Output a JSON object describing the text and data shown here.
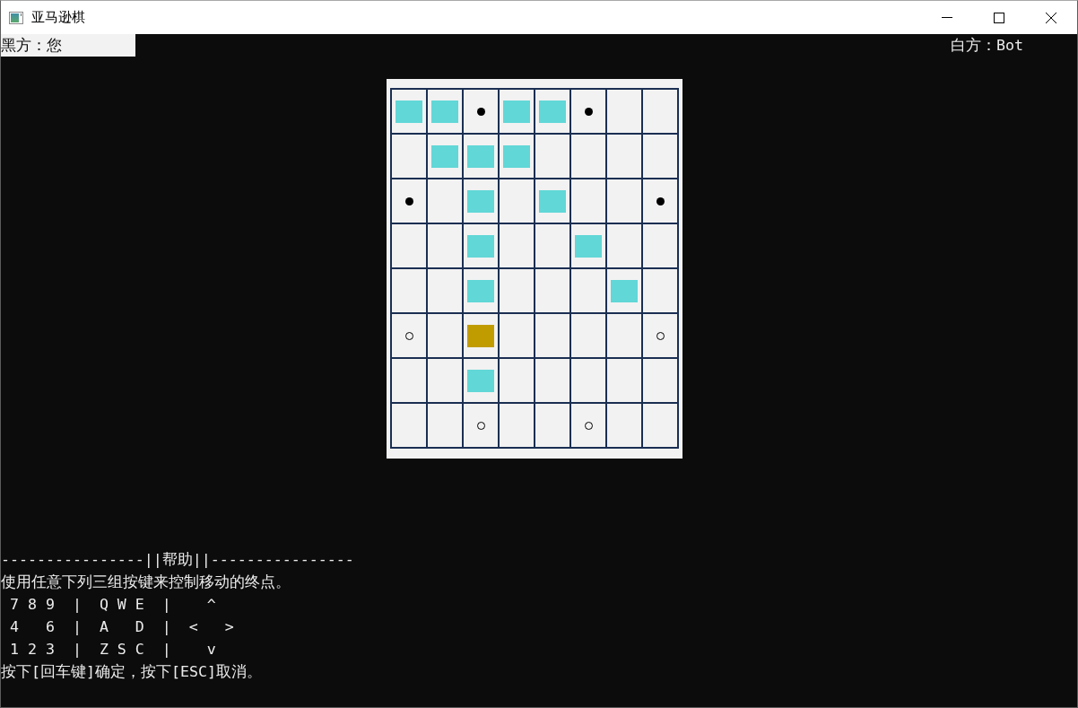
{
  "window": {
    "title": "亚马逊棋"
  },
  "players": [
    {
      "label": "黑方：您",
      "active": true
    },
    {
      "label": "白方：Bot",
      "active": false
    }
  ],
  "board": {
    "rows": [
      {
        "cells": [
          {
            "kind": "block",
            "selected": false
          },
          {
            "kind": "block",
            "selected": false
          },
          {
            "kind": "black",
            "selected": false
          },
          {
            "kind": "block",
            "selected": false
          },
          {
            "kind": "block",
            "selected": false
          },
          {
            "kind": "black",
            "selected": false
          },
          {
            "kind": "empty",
            "selected": false
          },
          {
            "kind": "empty",
            "selected": false
          }
        ]
      },
      {
        "cells": [
          {
            "kind": "empty",
            "selected": false
          },
          {
            "kind": "block",
            "selected": false
          },
          {
            "kind": "block",
            "selected": false
          },
          {
            "kind": "block",
            "selected": false
          },
          {
            "kind": "empty",
            "selected": false
          },
          {
            "kind": "empty",
            "selected": false
          },
          {
            "kind": "empty",
            "selected": false
          },
          {
            "kind": "empty",
            "selected": false
          }
        ]
      },
      {
        "cells": [
          {
            "kind": "black",
            "selected": false
          },
          {
            "kind": "empty",
            "selected": false
          },
          {
            "kind": "block",
            "selected": false
          },
          {
            "kind": "empty",
            "selected": false
          },
          {
            "kind": "block",
            "selected": false
          },
          {
            "kind": "empty",
            "selected": false
          },
          {
            "kind": "empty",
            "selected": false
          },
          {
            "kind": "black",
            "selected": false
          }
        ]
      },
      {
        "cells": [
          {
            "kind": "empty",
            "selected": false
          },
          {
            "kind": "empty",
            "selected": false
          },
          {
            "kind": "block",
            "selected": false
          },
          {
            "kind": "empty",
            "selected": false
          },
          {
            "kind": "empty",
            "selected": false
          },
          {
            "kind": "block",
            "selected": false
          },
          {
            "kind": "empty",
            "selected": false
          },
          {
            "kind": "empty",
            "selected": false
          }
        ]
      },
      {
        "cells": [
          {
            "kind": "empty",
            "selected": false
          },
          {
            "kind": "empty",
            "selected": false
          },
          {
            "kind": "block",
            "selected": false
          },
          {
            "kind": "empty",
            "selected": false
          },
          {
            "kind": "empty",
            "selected": false
          },
          {
            "kind": "empty",
            "selected": false
          },
          {
            "kind": "block",
            "selected": false
          },
          {
            "kind": "empty",
            "selected": false
          }
        ]
      },
      {
        "cells": [
          {
            "kind": "white",
            "selected": false
          },
          {
            "kind": "empty",
            "selected": false
          },
          {
            "kind": "empty",
            "selected": true
          },
          {
            "kind": "empty",
            "selected": false
          },
          {
            "kind": "empty",
            "selected": false
          },
          {
            "kind": "empty",
            "selected": false
          },
          {
            "kind": "empty",
            "selected": false
          },
          {
            "kind": "white",
            "selected": false
          }
        ]
      },
      {
        "cells": [
          {
            "kind": "empty",
            "selected": false
          },
          {
            "kind": "empty",
            "selected": false
          },
          {
            "kind": "block",
            "selected": false
          },
          {
            "kind": "empty",
            "selected": false
          },
          {
            "kind": "empty",
            "selected": false
          },
          {
            "kind": "empty",
            "selected": false
          },
          {
            "kind": "empty",
            "selected": false
          },
          {
            "kind": "empty",
            "selected": false
          }
        ]
      },
      {
        "cells": [
          {
            "kind": "empty",
            "selected": false
          },
          {
            "kind": "empty",
            "selected": false
          },
          {
            "kind": "white",
            "selected": false
          },
          {
            "kind": "empty",
            "selected": false
          },
          {
            "kind": "empty",
            "selected": false
          },
          {
            "kind": "white",
            "selected": false
          },
          {
            "kind": "empty",
            "selected": false
          },
          {
            "kind": "empty",
            "selected": false
          }
        ]
      }
    ]
  },
  "help": {
    "heading": "----------------||帮助||----------------",
    "lines": [
      "使用任意下列三组按键来控制移动的终点。",
      " 7 8 9  |  Q W E  |    ^",
      " 4   6  |  A   D  |  <   >",
      " 1 2 3  |  Z S C  |    v",
      "按下[回车键]确定，按下[ESC]取消。"
    ]
  }
}
